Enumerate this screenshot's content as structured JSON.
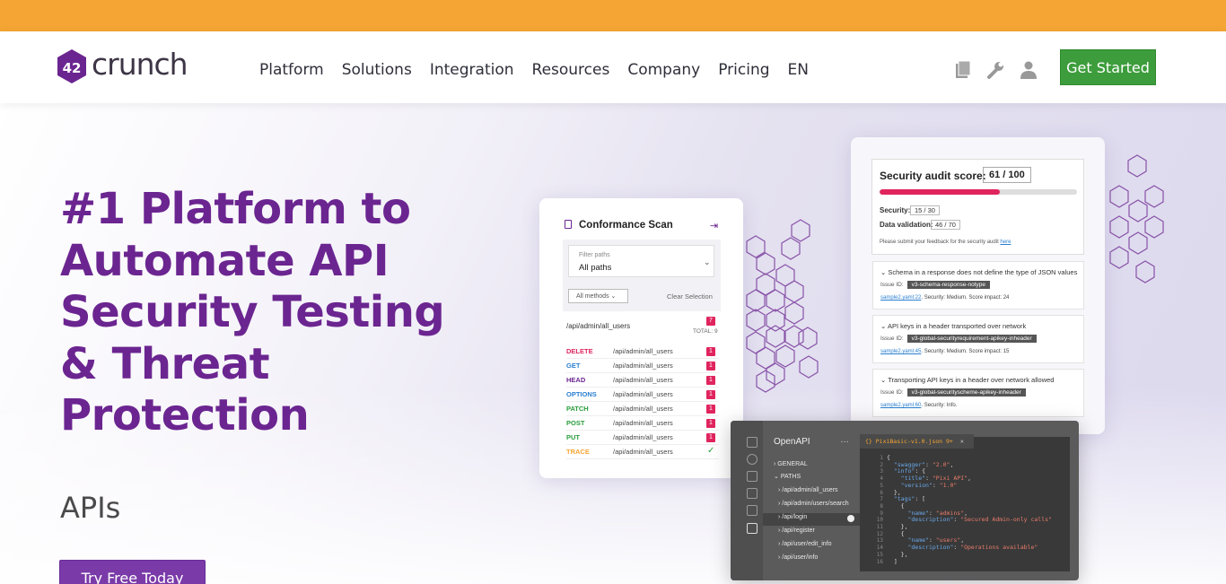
{
  "brand": {
    "logo_mark": "42",
    "logo_text": "crunch",
    "colors": {
      "topbar": "#f4a534",
      "purple": "#6b2590",
      "green": "#3d9d3c",
      "pink": "#e0245e"
    }
  },
  "nav": {
    "items": [
      "Platform",
      "Solutions",
      "Integration",
      "Resources",
      "Company",
      "Pricing",
      "EN"
    ],
    "icons": [
      "book-icon",
      "wrench-icon",
      "user-icon"
    ],
    "cta": "Get Started"
  },
  "hero": {
    "headline": [
      "#1 Platform to",
      "Automate API",
      "Security Testing",
      "& Threat",
      "Protection"
    ],
    "subhead": "APIs",
    "cta": "Try Free Today"
  },
  "conformance": {
    "title": "Conformance Scan",
    "filter_label": "Filter paths",
    "filter_value": "All paths",
    "methods": "All methods",
    "clear": "Clear Selection",
    "path": "/api/admin/all_users",
    "path_count": "7",
    "total": "TOTAL: 9",
    "rows": [
      {
        "method": "DELETE",
        "path": "/api/admin/all_users",
        "count": "1",
        "color": "#e0245e"
      },
      {
        "method": "GET",
        "path": "/api/admin/all_users",
        "count": "1",
        "color": "#2a7fd0"
      },
      {
        "method": "HEAD",
        "path": "/api/admin/all_users",
        "count": "1",
        "color": "#6b2590"
      },
      {
        "method": "OPTIONS",
        "path": "/api/admin/all_users",
        "count": "1",
        "color": "#2a7fd0"
      },
      {
        "method": "PATCH",
        "path": "/api/admin/all_users",
        "count": "1",
        "color": "#2a9d3c"
      },
      {
        "method": "POST",
        "path": "/api/admin/all_users",
        "count": "1",
        "color": "#2a9d3c"
      },
      {
        "method": "PUT",
        "path": "/api/admin/all_users",
        "count": "1",
        "color": "#2a9d3c"
      },
      {
        "method": "TRACE",
        "path": "/api/admin/all_users",
        "count": "",
        "color": "#f4a534"
      }
    ]
  },
  "audit": {
    "title": "Security audit score:",
    "score": "61 / 100",
    "score_fraction": 0.61,
    "security_label": "Security:",
    "security_value": "15 / 30",
    "validation_label": "Data validation:",
    "validation_value": "46 / 70",
    "feedback": "Please submit your feedback for the security audit",
    "feedback_link": "here",
    "issues": [
      {
        "title": "Schema in a response does not define the type of JSON values",
        "id_label": "Issue ID:",
        "id": "v3-schema-response-notype",
        "file": "sample2.yaml:22",
        "meta": ". Security: Medium. Score impact: 24"
      },
      {
        "title": "API keys in a header transported over network",
        "id_label": "Issue ID:",
        "id": "v3-global-securityrequirement-apikey-inheader",
        "file": "sample2.yaml:45",
        "meta": ". Security: Medium. Score impact: 15"
      },
      {
        "title": "Transporting API keys in a header over network allowed",
        "id_label": "Issue ID:",
        "id": "v3-global-securityscheme-apikey-inheader",
        "file": "sample2.yaml:60",
        "meta": ". Security: Info."
      }
    ]
  },
  "editor": {
    "title": "OpenAPI",
    "tab": "{} PixiBasic-v1.0.json 9+",
    "tree": [
      "GENERAL",
      "PATHS",
      "/api/admin/all_users",
      "/api/admin/users/search",
      "/api/login",
      "/api/register",
      "/api/user/edit_info",
      "/api/user/info"
    ],
    "line_numbers": [
      "1",
      "2",
      "3",
      "4",
      "5",
      "6",
      "7",
      "8",
      "9",
      "10",
      "11",
      "12",
      "13",
      "14",
      "15",
      "16"
    ]
  }
}
